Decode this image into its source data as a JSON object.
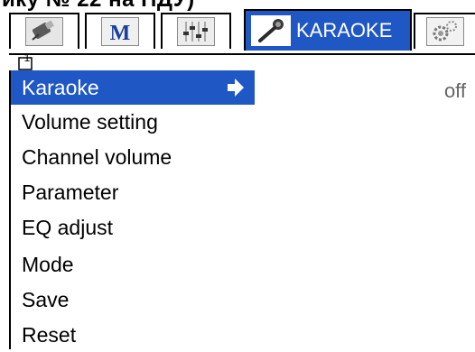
{
  "caption": "ику № 22 на ПДУ)",
  "tabs": [
    {
      "icon": "usb-icon",
      "label": ""
    },
    {
      "icon": "m-logo-icon",
      "label": ""
    },
    {
      "icon": "mixer-icon",
      "label": ""
    },
    {
      "icon": "microphone-icon",
      "label": "KARAOKE",
      "active": true
    },
    {
      "icon": "gear-icon",
      "label": ""
    }
  ],
  "menu": {
    "items": [
      {
        "label": "Karaoke",
        "selected": true
      },
      {
        "label": "Volume setting"
      },
      {
        "label": "Channel volume"
      },
      {
        "label": "Parameter"
      },
      {
        "label": "EQ adjust"
      },
      {
        "label": "Mode"
      },
      {
        "label": "Save"
      },
      {
        "label": "Reset"
      }
    ],
    "value": "off",
    "cursor_label": "1"
  },
  "colors": {
    "accent": "#1f57c4",
    "value_text": "#666666"
  }
}
